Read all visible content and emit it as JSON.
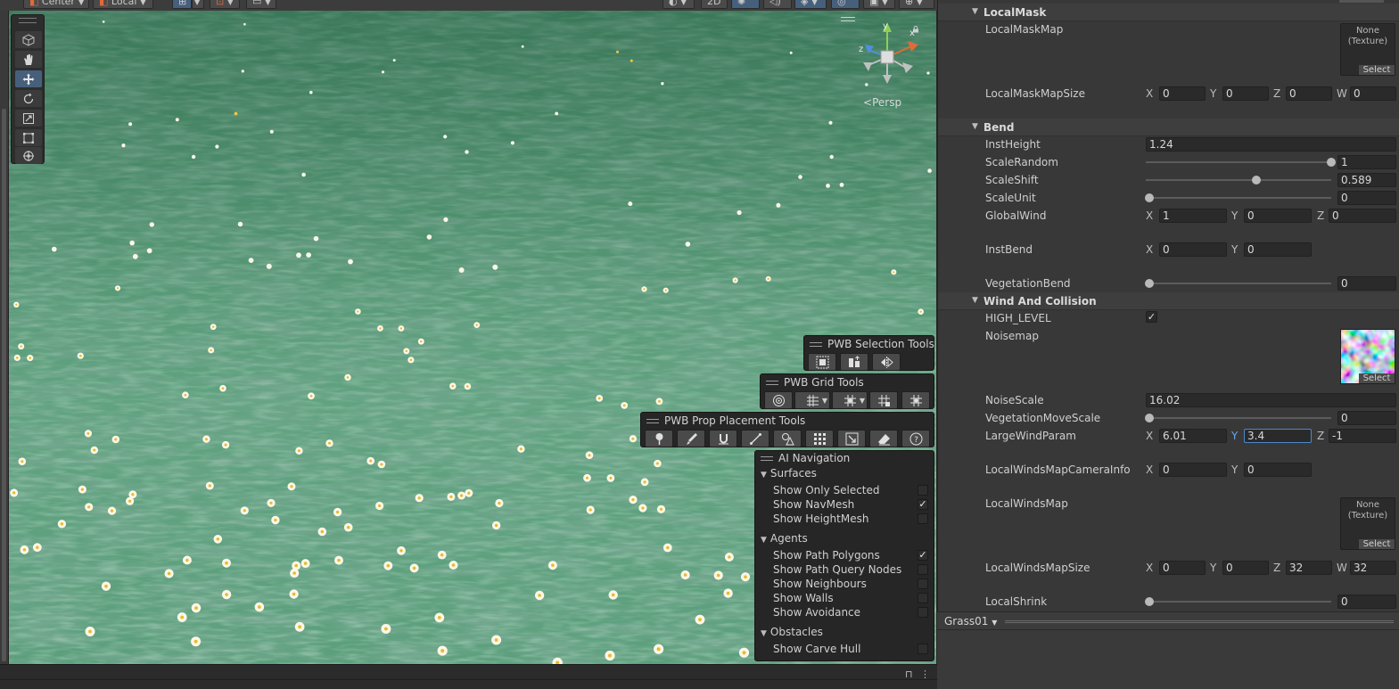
{
  "toolbar": {
    "pivot_label": "Center",
    "space_label": "Local",
    "two_d_label": "2D"
  },
  "scene": {
    "camera_label": "Persp",
    "gizmo_axes": {
      "x": "x",
      "y": "y",
      "z": "z"
    }
  },
  "tool_icons": [
    "view-tool-icon",
    "hand-icon",
    "move-icon",
    "rotate-icon",
    "scale-icon",
    "rect-tool-icon",
    "transform-icon"
  ],
  "pwb_selection": {
    "title": "PWB Selection Tools"
  },
  "pwb_grid": {
    "title": "PWB Grid Tools"
  },
  "pwb_prop": {
    "title": "PWB Prop Placement Tools"
  },
  "ai_navigation": {
    "title": "AI Navigation",
    "surfaces": {
      "label": "Surfaces",
      "items": [
        {
          "label": "Show Only Selected",
          "checked": false
        },
        {
          "label": "Show NavMesh",
          "checked": true
        },
        {
          "label": "Show HeightMesh",
          "checked": false
        }
      ]
    },
    "agents": {
      "label": "Agents",
      "items": [
        {
          "label": "Show Path Polygons",
          "checked": true
        },
        {
          "label": "Show Path Query Nodes",
          "checked": false
        },
        {
          "label": "Show Neighbours",
          "checked": false
        },
        {
          "label": "Show Walls",
          "checked": false
        },
        {
          "label": "Show Avoidance",
          "checked": false
        }
      ]
    },
    "obstacles": {
      "label": "Obstacles",
      "items": [
        {
          "label": "Show Carve Hull",
          "checked": false
        }
      ]
    }
  },
  "inspector": {
    "local_mask": {
      "header": "LocalMask",
      "map_label": "LocalMaskMap",
      "map_value": "None",
      "map_type": "(Texture)",
      "select_label": "Select",
      "size_label": "LocalMaskMapSize",
      "size": {
        "x": "0",
        "y": "0",
        "z": "0",
        "w": "0"
      }
    },
    "bend": {
      "header": "Bend",
      "inst_height_label": "InstHeight",
      "inst_height": "1.24",
      "scale_random_label": "ScaleRandom",
      "scale_random": "1",
      "scale_random_fraction": 1.0,
      "scale_shift_label": "ScaleShift",
      "scale_shift": "0.589",
      "scale_shift_fraction": 0.589,
      "scale_unit_label": "ScaleUnit",
      "scale_unit": "0",
      "scale_unit_fraction": 0,
      "global_wind_label": "GlobalWind",
      "global_wind": {
        "x": "1",
        "y": "0",
        "z": "0"
      },
      "inst_bend_label": "InstBend",
      "inst_bend": {
        "x": "0",
        "y": "0"
      },
      "vegetation_bend_label": "VegetationBend",
      "vegetation_bend": "0",
      "vegetation_bend_fraction": 0
    },
    "wind": {
      "header": "Wind And Collision",
      "high_level_label": "HIGH_LEVEL",
      "high_level": true,
      "noisemap_label": "Noisemap",
      "select_label": "Select",
      "noise_scale_label": "NoiseScale",
      "noise_scale": "16.02",
      "veg_move_label": "VegetationMoveScale",
      "veg_move": "0",
      "veg_move_fraction": 0,
      "large_wind_label": "LargeWindParam",
      "large_wind": {
        "x": "6.01",
        "y": "3.4",
        "z": "-1"
      },
      "camera_info_label": "LocalWindsMapCameraInfo",
      "camera_info": {
        "x": "0",
        "y": "0"
      },
      "winds_map_label": "LocalWindsMap",
      "winds_map_value": "None",
      "winds_map_type": "(Texture)",
      "winds_size_label": "LocalWindsMapSize",
      "winds_size": {
        "x": "0",
        "y": "0",
        "z": "32",
        "w": "32"
      },
      "shrink_label": "LocalShrink",
      "shrink": "0",
      "shrink_fraction": 0
    },
    "axis_labels": {
      "x": "X",
      "y": "Y",
      "z": "Z",
      "w": "W"
    }
  },
  "footer": {
    "asset_name": "Grass01"
  },
  "colors": {
    "selection_blue": "#46607c",
    "focus_blue": "#4b89c9",
    "grass_green": "#5a9d7b"
  }
}
